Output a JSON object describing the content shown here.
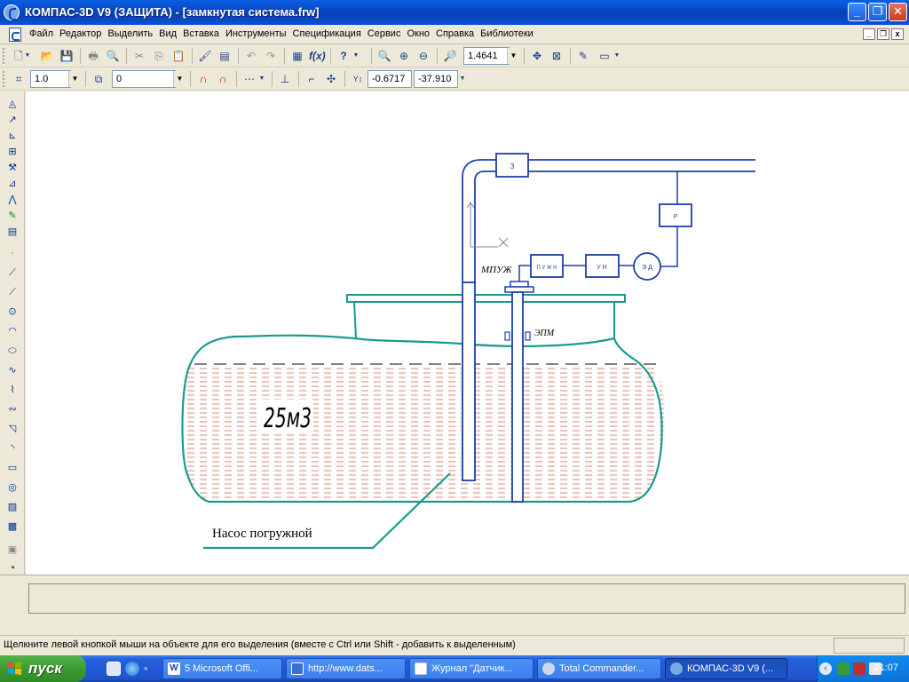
{
  "window": {
    "title": "КОМПАС-3D V9 (ЗАЩИТА) - [замкнутая система.frw]"
  },
  "menu": [
    "Файл",
    "Редактор",
    "Выделить",
    "Вид",
    "Вставка",
    "Инструменты",
    "Спецификация",
    "Сервис",
    "Окно",
    "Справка",
    "Библиотеки"
  ],
  "toolbar1": {
    "zoom_value": "1.4641"
  },
  "toolbar2": {
    "step_value": "1.0",
    "layer_value": "0",
    "coord_x": "-0.6717",
    "coord_y": "-37.910"
  },
  "drawing": {
    "tank_label": "25м3",
    "pump_label": "Насос погружной",
    "label_mpuzh": "МПУЖ",
    "label_epm": "ЭПМ",
    "box_z": "З",
    "box_r": "Р",
    "box_puzhn": "П У Ж Н",
    "box_un": "У Н",
    "box_ed": "Э Д"
  },
  "status": {
    "message": "Щелкните левой кнопкой мыши на объекте для его выделения (вместе с Ctrl или Shift - добавить к выделенным)"
  },
  "taskbar": {
    "start_label": "пуск",
    "tasks": [
      "5 Microsoft Offi...",
      "http://www.dats...",
      "Журнал \"Датчик...",
      "Total Commander...",
      "КОМПАС-3D V9 (..."
    ],
    "clock": "21:07"
  }
}
